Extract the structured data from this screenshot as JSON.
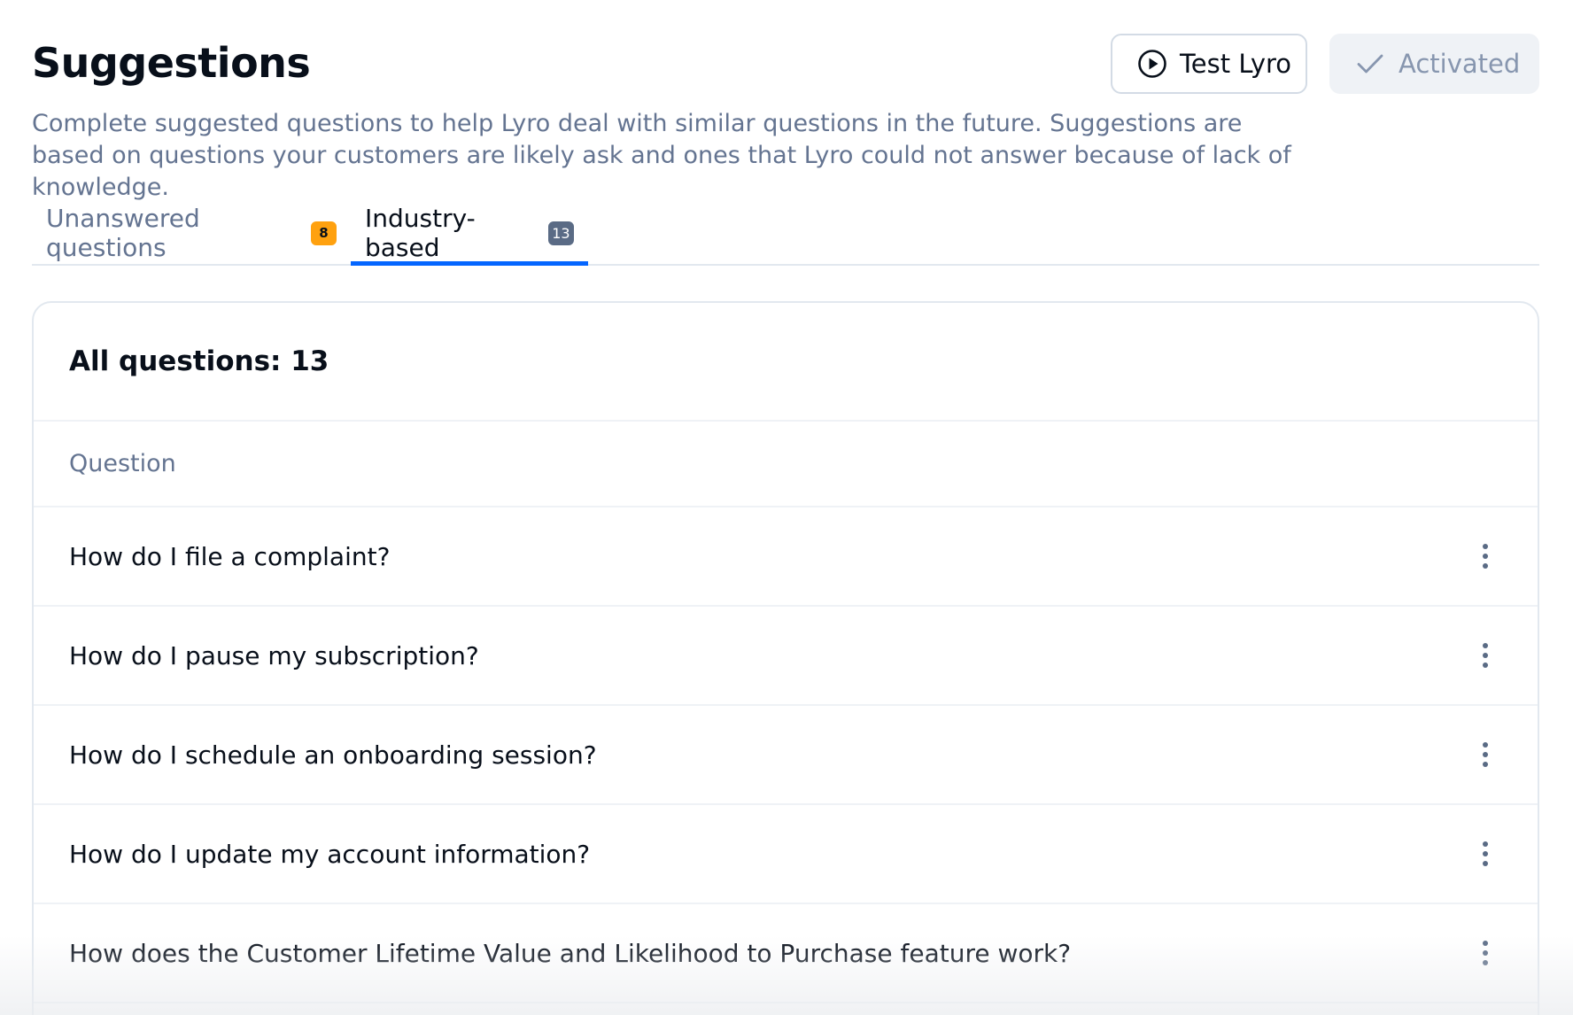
{
  "header": {
    "title": "Suggestions",
    "test_button_label": "Test Lyro",
    "test_button_icon": "play-circle-icon",
    "activated_label": "Activated",
    "activated_icon": "check-icon"
  },
  "description": "Complete suggested questions to help Lyro deal with similar questions in the future. Suggestions are based on questions your customers are likely ask and ones that Lyro could not answer because of lack of knowledge.",
  "tabs": [
    {
      "label": "Unanswered questions",
      "count": "8",
      "active": false
    },
    {
      "label": "Industry-based",
      "count": "13",
      "active": true
    }
  ],
  "table": {
    "title": "All questions: 13",
    "column_header": "Question",
    "rows": [
      {
        "question": "How do I file a complaint?"
      },
      {
        "question": "How do I pause my subscription?"
      },
      {
        "question": "How do I schedule an onboarding session?"
      },
      {
        "question": "How do I update my account information?"
      },
      {
        "question": "How does the Customer Lifetime Value and Likelihood to Purchase feature work?"
      }
    ],
    "row_menu_icon": "more-vertical-icon"
  },
  "colors": {
    "accent": "#0566FF",
    "badge_orange": "#FFA10F",
    "badge_gray": "#5A6B85",
    "muted_text": "#647491"
  }
}
